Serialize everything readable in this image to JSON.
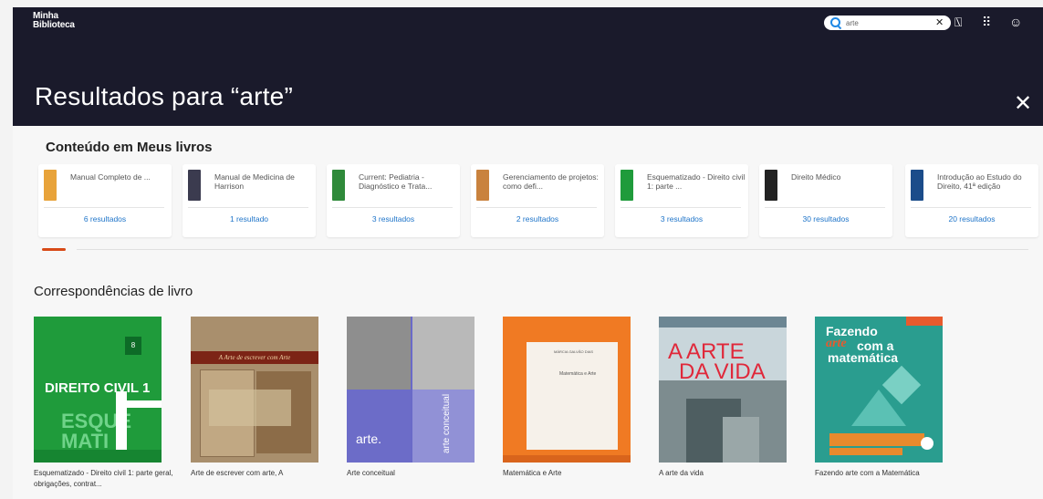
{
  "header": {
    "logo_line1": "Minha",
    "logo_line2": "Biblioteca",
    "search_value": "arte",
    "clear_glyph": "✕",
    "icons": [
      "search-icon",
      "close-icon",
      "reader-icon",
      "apps-grid-icon",
      "account-icon"
    ],
    "reader_glyph": "⍂",
    "grid_glyph": "⠿",
    "account_glyph": "☺",
    "page_title": "Resultados para “arte”",
    "close_glyph": "✕"
  },
  "meus_livros": {
    "title": "Conteúdo em Meus livros",
    "cards": [
      {
        "name": "Manual Completo de ...",
        "results": "6 resultados",
        "thumb_color": "#e8a33a"
      },
      {
        "name": "Manual de Medicina de Harrison",
        "results": "1 resultado",
        "thumb_color": "#3b3b4f"
      },
      {
        "name": "Current: Pediatria - Diagnóstico e Trata...",
        "results": "3 resultados",
        "thumb_color": "#2f8a3a"
      },
      {
        "name": "Gerenciamento de projetos: como defi...",
        "results": "2 resultados",
        "thumb_color": "#c9823e"
      },
      {
        "name": "Esquematizado - Direito civil 1: parte ...",
        "results": "3 resultados",
        "thumb_color": "#1f9b3b"
      },
      {
        "name": "Direito Médico",
        "results": "30 resultados",
        "thumb_color": "#222222"
      },
      {
        "name": "Introdução ao Estudo do Direito, 41ª edição",
        "results": "20 resultados",
        "thumb_color": "#1b4c8a"
      }
    ]
  },
  "correspondencias": {
    "title": "Correspondências de livro",
    "books": [
      {
        "label": "Esquematizado - Direito civil 1: parte geral, obrigações, contrat...",
        "cover_title": "DIREITO CIVIL 1",
        "cover_subtitle": "ESQUE MATI ZADO",
        "cover_number": "8"
      },
      {
        "label": "Arte de escrever com arte, A",
        "cover_title": "A Arte de escrever com Arte"
      },
      {
        "label": "Arte conceitual",
        "cover_title": "arte.",
        "cover_vertical": "arte conceitual"
      },
      {
        "label": "Matemática e Arte",
        "cover_author": "MÁRCIA GALVÃO DIAS",
        "cover_title": "Matemática e Arte"
      },
      {
        "label": "A arte da vida",
        "cover_title_line1": "A ARTE",
        "cover_title_line2": "DA VIDA"
      },
      {
        "label": "Fazendo arte com a Matemática",
        "cover_line1": "Fazendo",
        "cover_arte": "arte",
        "cover_line2": "com a",
        "cover_line3": "matemática"
      }
    ]
  },
  "colors": {
    "header_bg": "#1a1a2b",
    "link_blue": "#1e74c9",
    "accent_orange": "#d84a17"
  }
}
